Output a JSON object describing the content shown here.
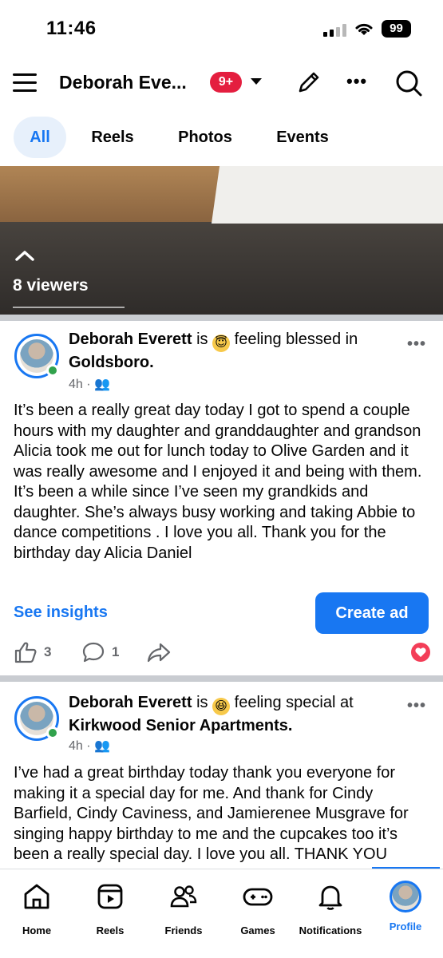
{
  "status": {
    "time": "11:46",
    "battery": "99"
  },
  "header": {
    "page_name": "Deborah Eve...",
    "badge": "9+"
  },
  "tabs": [
    {
      "label": "All"
    },
    {
      "label": "Reels"
    },
    {
      "label": "Photos"
    },
    {
      "label": "Events"
    }
  ],
  "story": {
    "viewers": "8 viewers"
  },
  "posts": [
    {
      "author": "Deborah Everett",
      "is": "is",
      "feeling": "feeling blessed",
      "in_word": "in",
      "place": "Goldsboro.",
      "time": "4h",
      "emoji": "😇",
      "body": "It’s been a really great day today I got to spend a couple hours with my daughter and granddaughter and grandson Alicia took me out for lunch today to Olive Garden and it was really awesome and I enjoyed it and being with them. It’s been a while since I’ve seen my grandkids and daughter. She’s always busy working and taking Abbie to dance competitions . I love you all. Thank you for the birthday day Alicia Daniel",
      "see_insights": "See insights",
      "create_ad": "Create ad",
      "likes": "3",
      "comments": "1"
    },
    {
      "author": "Deborah Everett",
      "is": "is",
      "feeling": "feeling special at",
      "place": "Kirkwood Senior Apartments.",
      "time": "4h",
      "emoji": "😆",
      "body": "I’ve had a great birthday today thank you everyone for making it a special day for me. And thank for Cindy Barfield, Cindy Caviness, and Jamierenee Musgrave for singing happy birthday to me and the cupcakes too it’s been a really special day. I love you all. THANK YOU"
    }
  ],
  "nav": [
    {
      "label": "Home"
    },
    {
      "label": "Reels"
    },
    {
      "label": "Friends"
    },
    {
      "label": "Games"
    },
    {
      "label": "Notifications"
    },
    {
      "label": "Profile"
    }
  ],
  "colors": {
    "accent": "#1877f2",
    "badge": "#e41e3f",
    "online": "#31a24c"
  }
}
